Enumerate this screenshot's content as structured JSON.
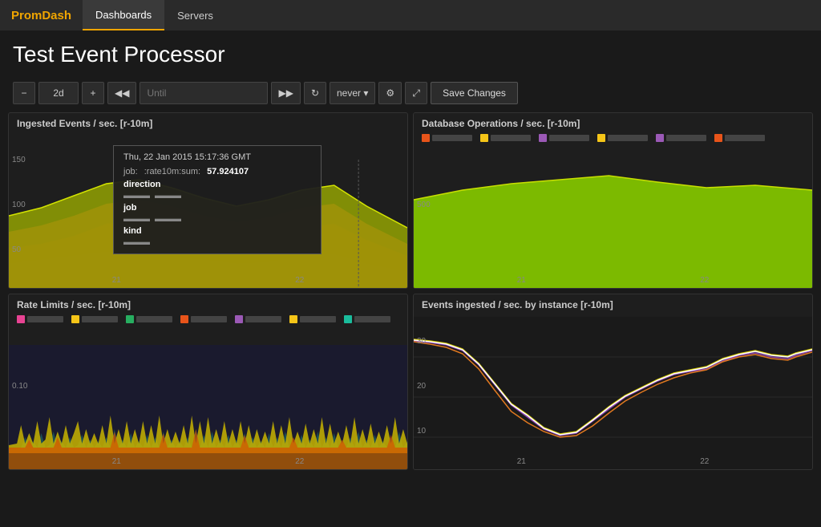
{
  "nav": {
    "brand": "PromDash",
    "items": [
      {
        "label": "Dashboards",
        "active": true
      },
      {
        "label": "Servers",
        "active": false
      }
    ]
  },
  "page": {
    "title": "Test Event Processor"
  },
  "toolbar": {
    "minus_label": "−",
    "interval_value": "2d",
    "plus_label": "+",
    "back2_label": "◀◀",
    "until_placeholder": "Until",
    "forward2_label": "▶▶",
    "refresh_icon": "↻",
    "never_label": "never ▾",
    "settings_icon": "⚙",
    "expand_icon": "⤢",
    "save_label": "Save Changes"
  },
  "panels": [
    {
      "id": "ingested-events",
      "title": "Ingested Events / sec. [r-10m]",
      "position": "top-left",
      "tooltip": {
        "timestamp": "Thu, 22 Jan 2015 15:17:36 GMT",
        "job_label": "job:",
        "job_value": ":rate10m:sum:",
        "metric_value": "57.924107",
        "rows": [
          "direction",
          "job",
          "kind"
        ]
      },
      "y_labels": [
        "150",
        "100",
        "50"
      ],
      "x_labels": [
        "21",
        "22"
      ]
    },
    {
      "id": "database-ops",
      "title": "Database Operations / sec. [r-10m]",
      "position": "top-right",
      "y_labels": [
        "500"
      ],
      "x_labels": [
        "21",
        "22"
      ],
      "legend_items": [
        {
          "color": "#e8541a"
        },
        {
          "color": "#f5c518"
        },
        {
          "color": "#9b59b6"
        },
        {
          "color": "#f5c518"
        },
        {
          "color": "#9b59b6"
        },
        {
          "color": "#f5c518"
        },
        {
          "color": "#9b59b6"
        },
        {
          "color": "#f5c518"
        }
      ]
    },
    {
      "id": "rate-limits",
      "title": "Rate Limits / sec. [r-10m]",
      "position": "bottom-left",
      "y_labels": [
        "0.10"
      ],
      "x_labels": [
        "21",
        "22"
      ],
      "legend_items": [
        {
          "color": "#e84393"
        },
        {
          "color": "#f5c518"
        },
        {
          "color": "#e8541a"
        },
        {
          "color": "#f5c518"
        },
        {
          "color": "#9b59b6"
        },
        {
          "color": "#f5c518"
        },
        {
          "color": "#9b59b6"
        },
        {
          "color": "#f5c518"
        }
      ]
    },
    {
      "id": "events-by-instance",
      "title": "Events ingested / sec. by instance [r-10m]",
      "position": "bottom-right",
      "y_labels": [
        "30",
        "20",
        "10"
      ],
      "x_labels": [
        "21",
        "22"
      ]
    }
  ],
  "colors": {
    "brand": "#f0a500",
    "nav_bg": "#2a2a2a",
    "panel_bg": "#1e1e1e"
  }
}
